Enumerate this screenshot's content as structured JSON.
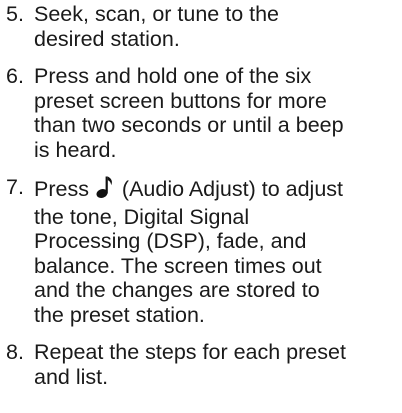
{
  "steps": [
    {
      "number": "5.",
      "text": "Seek, scan, or tune to the\ndesired station."
    },
    {
      "number": "6.",
      "text": "Press and hold one of the six\npreset screen buttons for more\nthan two seconds or until a beep\nis heard."
    },
    {
      "number": "7.",
      "text_before_icon": "Press ",
      "icon": "music-note-icon",
      "text_after_icon": " (Audio Adjust) to adjust\nthe tone, Digital Signal\nProcessing (DSP), fade, and\nbalance. The screen times out\nand the changes are stored to\nthe preset station."
    },
    {
      "number": "8.",
      "text": "Repeat the steps for each preset\nand list."
    }
  ]
}
